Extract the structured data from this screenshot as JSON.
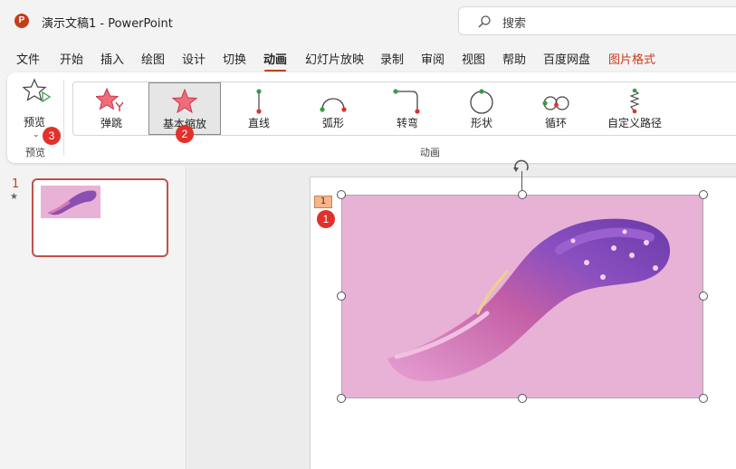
{
  "app": {
    "icon_letter": "P",
    "title": "演示文稿1  -  PowerPoint"
  },
  "search": {
    "placeholder": "搜索"
  },
  "tabs": [
    {
      "label": "文件"
    },
    {
      "label": "开始"
    },
    {
      "label": "插入"
    },
    {
      "label": "绘图"
    },
    {
      "label": "设计"
    },
    {
      "label": "切换"
    },
    {
      "label": "动画"
    },
    {
      "label": "幻灯片放映"
    },
    {
      "label": "录制"
    },
    {
      "label": "审阅"
    },
    {
      "label": "视图"
    },
    {
      "label": "帮助"
    },
    {
      "label": "百度网盘"
    },
    {
      "label": "图片格式"
    }
  ],
  "active_tab": "动画",
  "ribbon": {
    "preview": {
      "label": "预览",
      "group_label": "预览",
      "chevron": "⌄"
    },
    "animations": [
      {
        "label": "弹跳",
        "icon": "bounce-star-icon"
      },
      {
        "label": "基本缩放",
        "icon": "zoom-star-icon",
        "selected": true
      },
      {
        "label": "直线",
        "icon": "line-path-icon"
      },
      {
        "label": "弧形",
        "icon": "arc-path-icon"
      },
      {
        "label": "转弯",
        "icon": "turn-path-icon"
      },
      {
        "label": "形状",
        "icon": "shape-path-icon"
      },
      {
        "label": "循环",
        "icon": "loop-path-icon"
      },
      {
        "label": "自定义路径",
        "icon": "custom-path-icon"
      }
    ],
    "group_label": "动画"
  },
  "badges": {
    "picture": "1",
    "zoom": "2",
    "preview": "3"
  },
  "thumbnails": {
    "slide_number": "1",
    "star": "★"
  },
  "slide": {
    "anim_tag": "1"
  },
  "colors": {
    "accent": "#c43e1c",
    "badge": "#e0312b",
    "picture_bg": "#e8b2d6",
    "star_fill": "#f26b7a"
  }
}
